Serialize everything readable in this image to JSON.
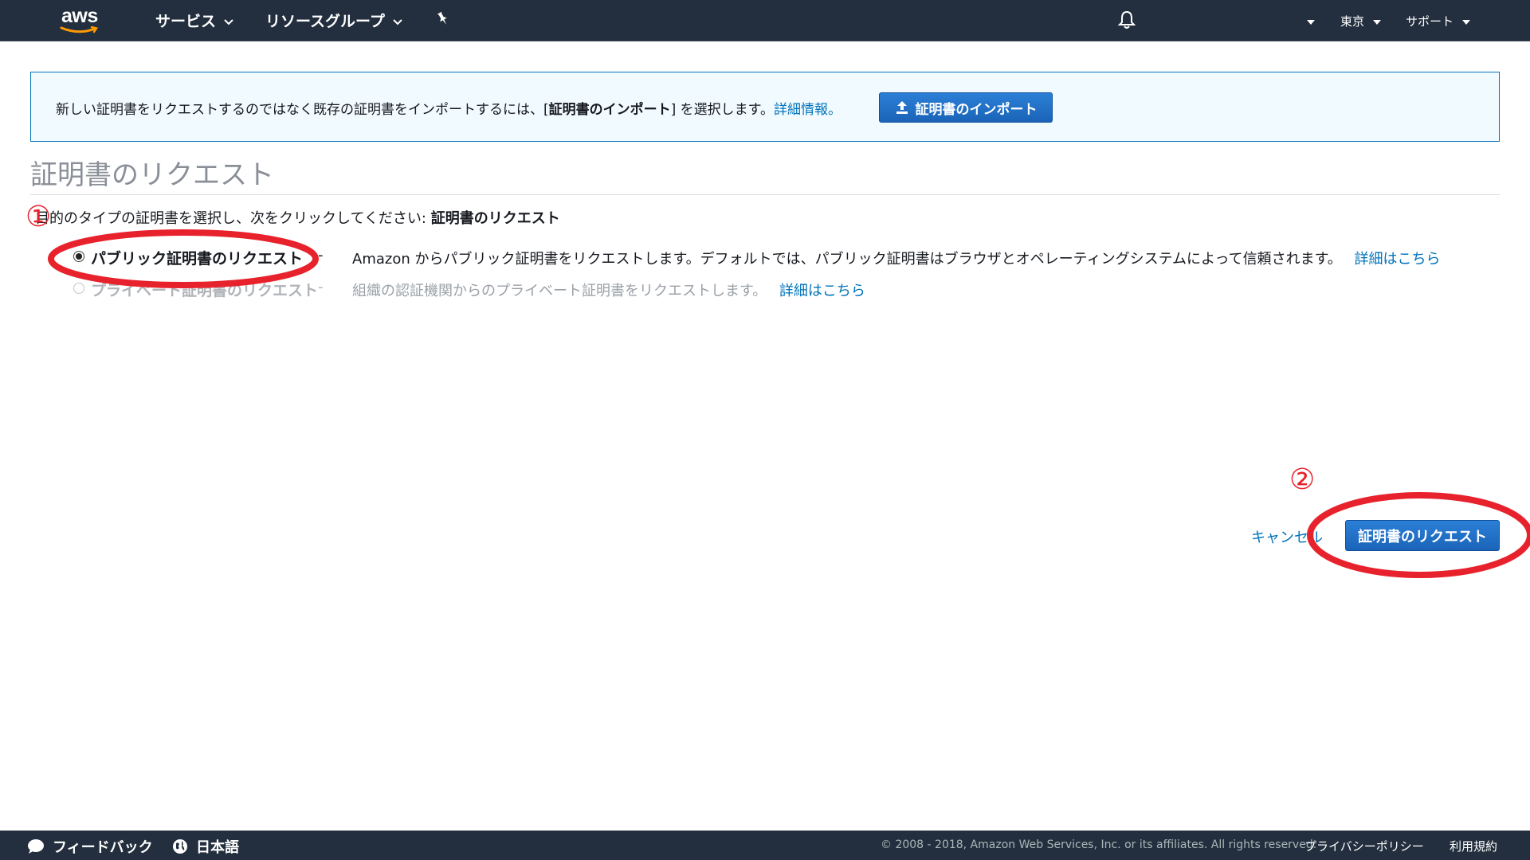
{
  "header": {
    "logo_text": "aws",
    "services": "サービス",
    "resource_groups": "リソースグループ",
    "pin_icon": "pin-icon",
    "bell_icon": "bell-icon",
    "region": "東京",
    "support": "サポート"
  },
  "info_banner": {
    "text_prefix": "新しい証明書をリクエストするのではなく既存の証明書をインポートするには、[",
    "text_bold": "証明書のインポート",
    "text_suffix": "] を選択します。",
    "link": "詳細情報。",
    "import_button": "証明書のインポート",
    "import_icon": "upload-icon"
  },
  "main": {
    "title": "証明書のリクエスト",
    "instruction_prefix": "目的のタイプの証明書を選択し、次をクリックしてください: ",
    "instruction_bold": "証明書のリクエスト",
    "options": [
      {
        "label": "パブリック証明書のリクエスト",
        "dash": "-",
        "description": "Amazon からパブリック証明書をリクエストします。デフォルトでは、パブリック証明書はブラウザとオペレーティングシステムによって信頼されます。",
        "link": "詳細はこちら",
        "selected": true,
        "disabled": false
      },
      {
        "label": "プライベート証明書のリクエスト",
        "dash": "-",
        "description": "組織の認証機関からのプライベート証明書をリクエストします。",
        "link": "詳細はこちら",
        "selected": false,
        "disabled": true
      }
    ],
    "cancel": "キャンセル",
    "request_button": "証明書のリクエスト"
  },
  "annotations": {
    "marker_1": "①",
    "marker_2": "②",
    "color": "#e8222c"
  },
  "footer": {
    "feedback": "フィードバック",
    "language": "日本語",
    "copyright": "© 2008 - 2018, Amazon Web Services, Inc. or its affiliates. All rights reserved.",
    "privacy": "プライバシーポリシー",
    "terms": "利用規約"
  },
  "colors": {
    "nav_bg": "#232f3e",
    "primary_button": "#1a64b8",
    "link": "#0073bb",
    "banner_bg": "#f1faff"
  }
}
